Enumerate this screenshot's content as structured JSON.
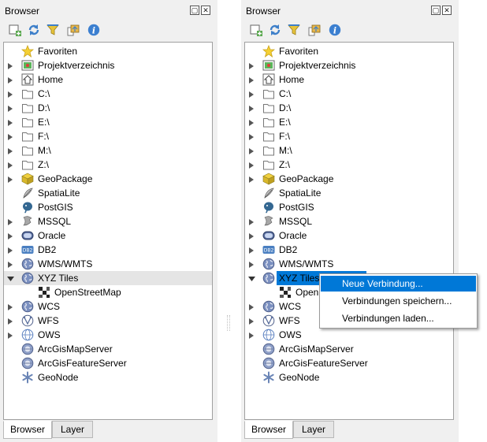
{
  "panels": [
    {
      "title": "Browser",
      "float_glyph": "▢",
      "close_glyph": "✕",
      "toolbar": [
        "add-layer",
        "refresh",
        "filter",
        "collapse-all",
        "info"
      ],
      "items": [
        {
          "label": "Favoriten",
          "icon": "star-icon",
          "arrow": "none"
        },
        {
          "label": "Projektverzeichnis",
          "icon": "project-folder-icon",
          "arrow": "right"
        },
        {
          "label": "Home",
          "icon": "home-icon",
          "arrow": "right"
        },
        {
          "label": "C:\\",
          "icon": "folder-icon",
          "arrow": "right"
        },
        {
          "label": "D:\\",
          "icon": "folder-icon",
          "arrow": "right"
        },
        {
          "label": "E:\\",
          "icon": "folder-icon",
          "arrow": "right"
        },
        {
          "label": "F:\\",
          "icon": "folder-icon",
          "arrow": "right"
        },
        {
          "label": "M:\\",
          "icon": "folder-icon",
          "arrow": "right"
        },
        {
          "label": "Z:\\",
          "icon": "folder-icon",
          "arrow": "right"
        },
        {
          "label": "GeoPackage",
          "icon": "geopackage-icon",
          "arrow": "right"
        },
        {
          "label": "SpatiaLite",
          "icon": "spatialite-icon",
          "arrow": "none"
        },
        {
          "label": "PostGIS",
          "icon": "postgis-icon",
          "arrow": "none"
        },
        {
          "label": "MSSQL",
          "icon": "mssql-icon",
          "arrow": "right"
        },
        {
          "label": "Oracle",
          "icon": "oracle-icon",
          "arrow": "right"
        },
        {
          "label": "DB2",
          "icon": "db2-icon",
          "arrow": "right"
        },
        {
          "label": "WMS/WMTS",
          "icon": "globe-icon",
          "arrow": "right"
        },
        {
          "label": "XYZ Tiles",
          "icon": "globe-icon",
          "arrow": "down",
          "selected": true
        },
        {
          "label": "OpenStreetMap",
          "icon": "tiles-icon",
          "arrow": "none",
          "child": true
        },
        {
          "label": "WCS",
          "icon": "globe-icon",
          "arrow": "right"
        },
        {
          "label": "WFS",
          "icon": "wfs-icon",
          "arrow": "right"
        },
        {
          "label": "OWS",
          "icon": "ows-icon",
          "arrow": "right"
        },
        {
          "label": "ArcGisMapServer",
          "icon": "arcgis-icon",
          "arrow": "none"
        },
        {
          "label": "ArcGisFeatureServer",
          "icon": "arcgis-icon",
          "arrow": "none"
        },
        {
          "label": "GeoNode",
          "icon": "geonode-icon",
          "arrow": "none"
        }
      ],
      "tabs": [
        {
          "label": "Browser",
          "active": true
        },
        {
          "label": "Layer",
          "active": false
        }
      ]
    },
    {
      "title": "Browser",
      "float_glyph": "▢",
      "close_glyph": "✕",
      "toolbar": [
        "add-layer",
        "refresh",
        "filter",
        "collapse-all",
        "info"
      ],
      "items": [
        {
          "label": "Favoriten",
          "icon": "star-icon",
          "arrow": "none"
        },
        {
          "label": "Projektverzeichnis",
          "icon": "project-folder-icon",
          "arrow": "right"
        },
        {
          "label": "Home",
          "icon": "home-icon",
          "arrow": "right"
        },
        {
          "label": "C:\\",
          "icon": "folder-icon",
          "arrow": "right"
        },
        {
          "label": "D:\\",
          "icon": "folder-icon",
          "arrow": "right"
        },
        {
          "label": "E:\\",
          "icon": "folder-icon",
          "arrow": "right"
        },
        {
          "label": "F:\\",
          "icon": "folder-icon",
          "arrow": "right"
        },
        {
          "label": "M:\\",
          "icon": "folder-icon",
          "arrow": "right"
        },
        {
          "label": "Z:\\",
          "icon": "folder-icon",
          "arrow": "right"
        },
        {
          "label": "GeoPackage",
          "icon": "geopackage-icon",
          "arrow": "right"
        },
        {
          "label": "SpatiaLite",
          "icon": "spatialite-icon",
          "arrow": "none"
        },
        {
          "label": "PostGIS",
          "icon": "postgis-icon",
          "arrow": "none"
        },
        {
          "label": "MSSQL",
          "icon": "mssql-icon",
          "arrow": "right"
        },
        {
          "label": "Oracle",
          "icon": "oracle-icon",
          "arrow": "right"
        },
        {
          "label": "DB2",
          "icon": "db2-icon",
          "arrow": "right"
        },
        {
          "label": "WMS/WMTS",
          "icon": "globe-icon",
          "arrow": "right"
        },
        {
          "label": "XYZ Tiles",
          "icon": "globe-icon",
          "arrow": "down",
          "selected": true,
          "highlight": true
        },
        {
          "label": "OpenS",
          "icon": "tiles-icon",
          "arrow": "none",
          "child": true
        },
        {
          "label": "WCS",
          "icon": "globe-icon",
          "arrow": "right"
        },
        {
          "label": "WFS",
          "icon": "wfs-icon",
          "arrow": "right"
        },
        {
          "label": "OWS",
          "icon": "ows-icon",
          "arrow": "right"
        },
        {
          "label": "ArcGisMapServer",
          "icon": "arcgis-icon",
          "arrow": "none"
        },
        {
          "label": "ArcGisFeatureServer",
          "icon": "arcgis-icon",
          "arrow": "none"
        },
        {
          "label": "GeoNode",
          "icon": "geonode-icon",
          "arrow": "none"
        }
      ],
      "tabs": [
        {
          "label": "Browser",
          "active": true
        },
        {
          "label": "Layer",
          "active": false
        }
      ]
    }
  ],
  "context_menu": {
    "items": [
      {
        "label": "Neue Verbindung...",
        "highlighted": true
      },
      {
        "label": "Verbindungen speichern...",
        "highlighted": false
      },
      {
        "label": "Verbindungen laden...",
        "highlighted": false
      }
    ]
  },
  "colors": {
    "selection_blue": "#0078d7",
    "row_selected": "#e5e5e5"
  }
}
